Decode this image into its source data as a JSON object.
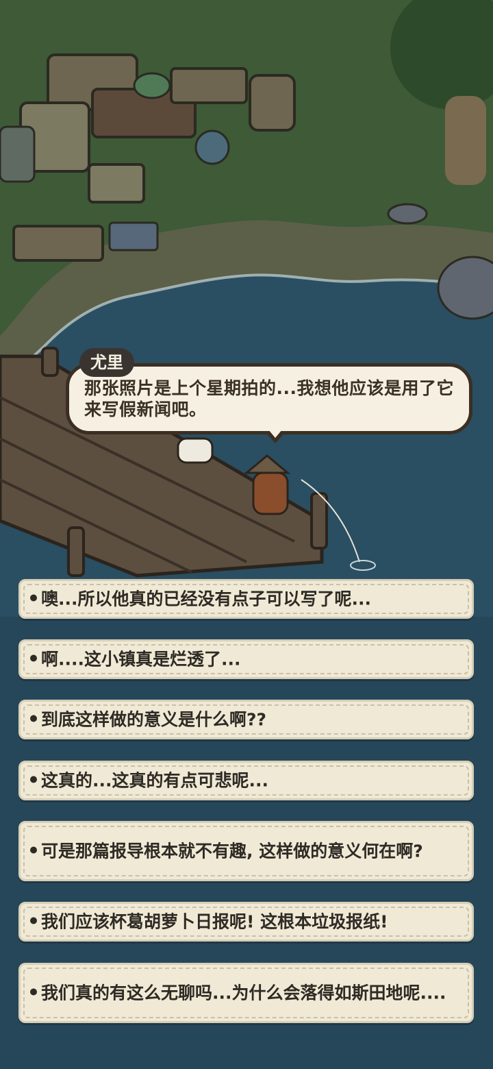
{
  "dialog": {
    "speaker": "尤里",
    "text": "那张照片是上个星期拍的...我想他应该是用了它来写假新闻吧。"
  },
  "choices": [
    {
      "text": "噢...所以他真的已经没有点子可以写了呢..."
    },
    {
      "text": "啊....这小镇真是烂透了..."
    },
    {
      "text": "到底这样做的意义是什么啊??"
    },
    {
      "text": "这真的...这真的有点可悲呢..."
    },
    {
      "text": "可是那篇报导根本就不有趣, 这样做的意义何在啊?"
    },
    {
      "text": "我们应该杯葛胡萝卜日报呢! 这根本垃圾报纸!"
    },
    {
      "text": "我们真的有这么无聊吗...为什么会落得如斯田地呢...."
    }
  ],
  "colors": {
    "grass": "#3e5a37",
    "water": "#2a4e62",
    "dock": "#5c4f40",
    "bubble": "#f5f0e2",
    "choice_bg": "#efe9d6"
  }
}
